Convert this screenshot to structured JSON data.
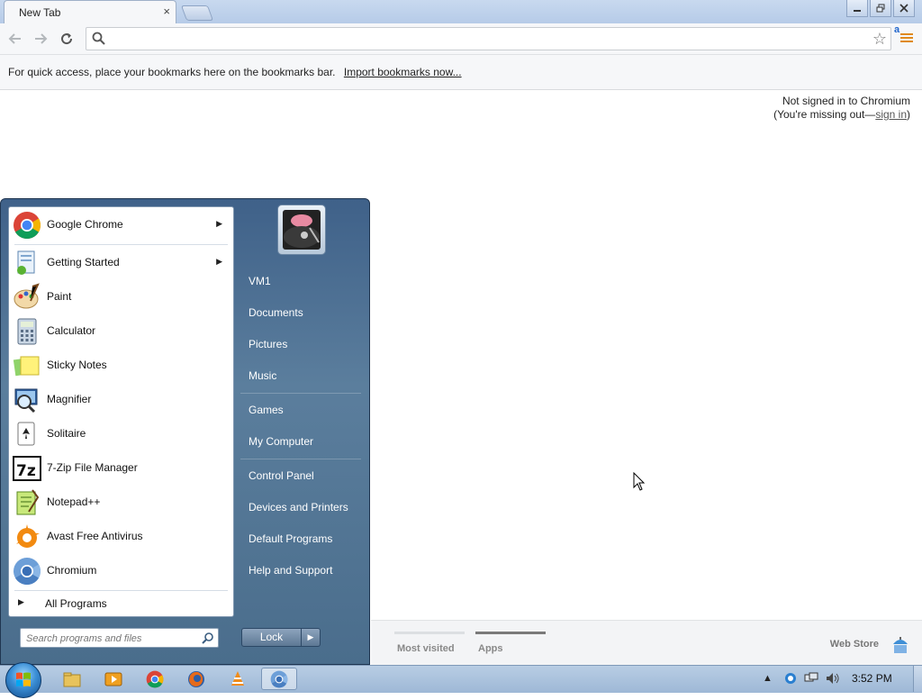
{
  "browser": {
    "tab_title": "New Tab",
    "tab_close": "×",
    "omnibox_value": "",
    "extension_label": "a",
    "bookmarks_hint": "For quick access, place your bookmarks here on the bookmarks bar.",
    "bookmarks_import_link": "Import bookmarks now...",
    "signin_line1": "Not signed in to Chromium",
    "signin_line2_prefix": "(You're missing out—",
    "signin_link": "sign in",
    "signin_line2_suffix": ")",
    "ntp_tabs": [
      {
        "label": "Most visited",
        "active": false
      },
      {
        "label": "Apps",
        "active": true
      }
    ],
    "web_store": "Web Store"
  },
  "start_menu": {
    "programs": [
      {
        "name": "Google Chrome",
        "icon": "chrome-icon",
        "has_submenu": true
      },
      {
        "name": "Getting Started",
        "icon": "getting-started-icon",
        "has_submenu": true
      },
      {
        "name": "Paint",
        "icon": "paint-icon",
        "has_submenu": false
      },
      {
        "name": "Calculator",
        "icon": "calculator-icon",
        "has_submenu": false
      },
      {
        "name": "Sticky Notes",
        "icon": "sticky-notes-icon",
        "has_submenu": false
      },
      {
        "name": "Magnifier",
        "icon": "magnifier-icon",
        "has_submenu": false
      },
      {
        "name": "Solitaire",
        "icon": "solitaire-icon",
        "has_submenu": false
      },
      {
        "name": "7-Zip File Manager",
        "icon": "7zip-icon",
        "has_submenu": false
      },
      {
        "name": "Notepad++",
        "icon": "notepadpp-icon",
        "has_submenu": false
      },
      {
        "name": "Avast Free Antivirus",
        "icon": "avast-icon",
        "has_submenu": false
      },
      {
        "name": "Chromium",
        "icon": "chromium-icon",
        "has_submenu": false
      }
    ],
    "all_programs": "All Programs",
    "search_placeholder": "Search programs and files",
    "right_links": [
      "VM1",
      "Documents",
      "Pictures",
      "Music",
      "Games",
      "My Computer",
      "Control Panel",
      "Devices and Printers",
      "Default Programs",
      "Help and Support"
    ],
    "lock_label": "Lock"
  },
  "taskbar": {
    "items": [
      "explorer-icon",
      "media-player-icon",
      "chrome-icon",
      "firefox-icon",
      "vlc-icon",
      "chromium-icon"
    ],
    "clock": "3:52 PM"
  },
  "colors": {
    "accent_orange": "#e08a1e",
    "start_menu_blue": "#4a6d8c",
    "taskbar_blue": "#9eb8d6"
  }
}
